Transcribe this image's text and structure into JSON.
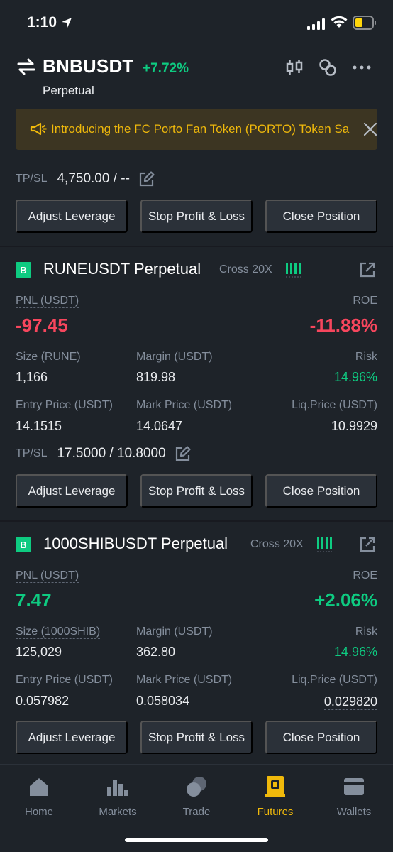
{
  "status": {
    "time": "1:10"
  },
  "header": {
    "symbol": "BNBUSDT",
    "change": "+7.72%",
    "subtitle": "Perpetual"
  },
  "banner": {
    "text": "Introducing the FC Porto Fan Token (PORTO) Token Sa"
  },
  "top_tpsl": {
    "label": "TP/SL",
    "value": "4,750.00 / --"
  },
  "buttons": {
    "adjust": "Adjust Leverage",
    "stop": "Stop Profit & Loss",
    "close": "Close Position"
  },
  "positions": [
    {
      "badge": "B",
      "name": "RUNEUSDT Perpetual",
      "mode": "Cross 20X",
      "pnl_label": "PNL (USDT)",
      "pnl": "-97.45",
      "roe_label": "ROE",
      "roe": "-11.88%",
      "size_label": "Size (RUNE)",
      "size": "1,166",
      "margin_label": "Margin (USDT)",
      "margin": "819.98",
      "risk_label": "Risk",
      "risk": "14.96%",
      "entry_label": "Entry Price (USDT)",
      "entry": "14.1515",
      "mark_label": "Mark Price (USDT)",
      "mark": "14.0647",
      "liq_label": "Liq.Price (USDT)",
      "liq": "10.9929",
      "tpsl_label": "TP/SL",
      "tpsl": "17.5000 / 10.8000"
    },
    {
      "badge": "B",
      "name": "1000SHIBUSDT Perpetual",
      "mode": "Cross 20X",
      "pnl_label": "PNL (USDT)",
      "pnl": "7.47",
      "roe_label": "ROE",
      "roe": "+2.06%",
      "size_label": "Size (1000SHIB)",
      "size": "125,029",
      "margin_label": "Margin (USDT)",
      "margin": "362.80",
      "risk_label": "Risk",
      "risk": "14.96%",
      "entry_label": "Entry Price (USDT)",
      "entry": "0.057982",
      "mark_label": "Mark Price (USDT)",
      "mark": "0.058034",
      "liq_label": "Liq.Price (USDT)",
      "liq": "0.029820"
    }
  ],
  "tabs": [
    {
      "label": "Home",
      "icon": "home-icon"
    },
    {
      "label": "Markets",
      "icon": "markets-icon"
    },
    {
      "label": "Trade",
      "icon": "trade-icon"
    },
    {
      "label": "Futures",
      "icon": "futures-icon",
      "active": true
    },
    {
      "label": "Wallets",
      "icon": "wallet-icon"
    }
  ],
  "colors": {
    "positive": "#0ecb81",
    "negative": "#f6465d",
    "accent": "#f0b90b",
    "background": "#1e2329"
  }
}
